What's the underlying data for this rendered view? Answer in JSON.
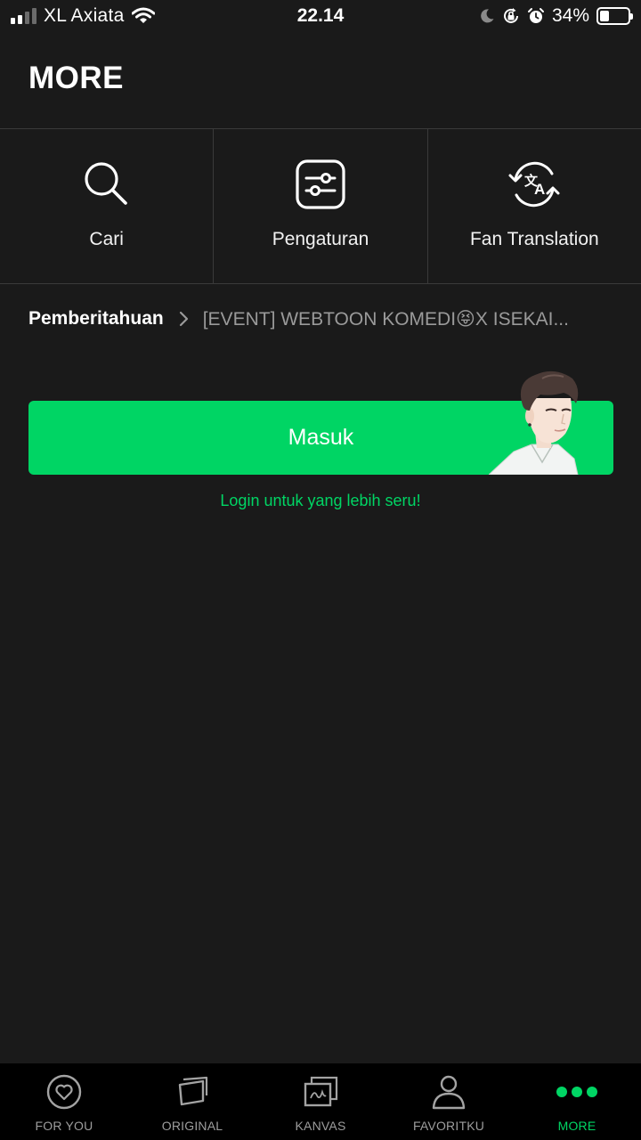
{
  "status_bar": {
    "carrier": "XL Axiata",
    "time": "22.14",
    "battery_percent": "34%",
    "battery_level": 0.34,
    "icons": [
      "signal-icon",
      "wifi-icon",
      "moon-icon",
      "rotation-lock-icon",
      "alarm-icon",
      "battery-icon"
    ]
  },
  "header": {
    "title": "MORE"
  },
  "quick_actions": [
    {
      "label": "Cari",
      "icon": "search-icon"
    },
    {
      "label": "Pengaturan",
      "icon": "settings-sliders-icon"
    },
    {
      "label": "Fan Translation",
      "icon": "translate-icon"
    }
  ],
  "notice": {
    "title": "Pemberitahuan",
    "text": "[EVENT] WEBTOON KOMEDI😝X ISEKAI..."
  },
  "login": {
    "button_label": "Masuk",
    "hint": "Login untuk yang lebih seru!"
  },
  "bottom_nav": {
    "active": "MORE",
    "items": [
      {
        "label": "FOR YOU",
        "icon": "heart-icon"
      },
      {
        "label": "ORIGINAL",
        "icon": "original-cards-icon"
      },
      {
        "label": "KANVAS",
        "icon": "canvas-icon"
      },
      {
        "label": "FAVORITKU",
        "icon": "person-icon"
      },
      {
        "label": "MORE",
        "icon": "more-dots-icon"
      }
    ]
  },
  "colors": {
    "background": "#1a1a1a",
    "accent": "#00d564",
    "divider": "#3a3a3a",
    "nav_background": "#000000",
    "muted_text": "#9a9a9a"
  }
}
